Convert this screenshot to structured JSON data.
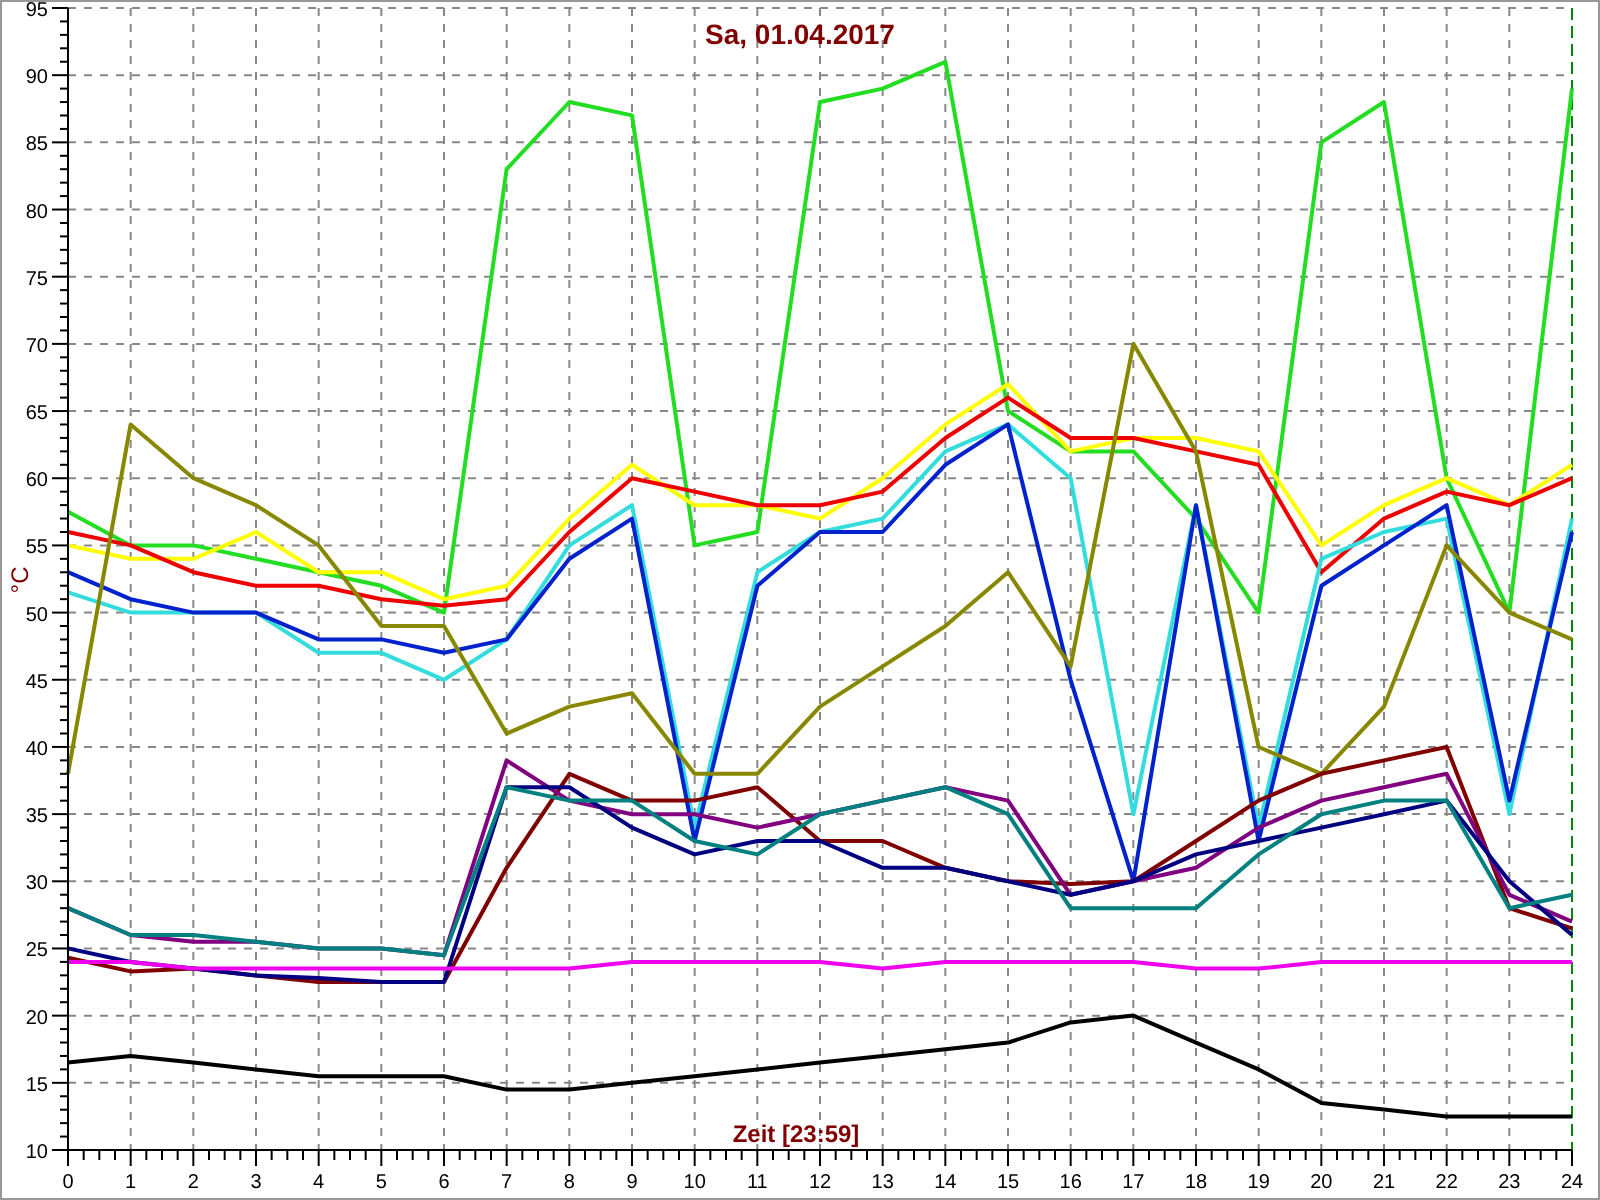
{
  "chart": {
    "chart_data": {
      "type": "line",
      "title": "Sa, 01.04.2017",
      "xlabel": "Zeit [23:59]",
      "ylabel": "°C",
      "x": [
        0,
        1,
        2,
        3,
        4,
        5,
        6,
        7,
        8,
        9,
        10,
        11,
        12,
        13,
        14,
        15,
        16,
        17,
        18,
        19,
        20,
        21,
        22,
        23,
        24
      ],
      "grid": true,
      "xlim": [
        0,
        24
      ],
      "ylim": [
        10,
        95
      ],
      "xticks": [
        0,
        1,
        2,
        3,
        4,
        5,
        6,
        7,
        8,
        9,
        10,
        11,
        12,
        13,
        14,
        15,
        16,
        17,
        18,
        19,
        20,
        21,
        22,
        23,
        24
      ],
      "yticks": [
        10,
        15,
        20,
        25,
        30,
        35,
        40,
        45,
        50,
        55,
        60,
        65,
        70,
        75,
        80,
        85,
        90,
        95
      ],
      "series": [
        {
          "color": "#22dd22",
          "values": [
            57.5,
            55,
            55,
            54,
            53,
            52,
            50,
            83,
            88,
            87,
            55,
            56,
            88,
            89,
            91,
            65,
            62,
            62,
            57,
            50,
            85,
            88,
            60,
            50,
            89
          ]
        },
        {
          "color": "#ffff00",
          "values": [
            55,
            54,
            54,
            56,
            53,
            53,
            51,
            52,
            57,
            61,
            58,
            58,
            57,
            60,
            64,
            67,
            62,
            63,
            63,
            62,
            55,
            58,
            60,
            58,
            61
          ]
        },
        {
          "color": "#ee0000",
          "values": [
            56,
            55,
            53,
            52,
            52,
            51,
            50.5,
            51,
            56,
            60,
            59,
            58,
            58,
            59,
            63,
            66,
            63,
            63,
            62,
            61,
            53,
            57,
            59,
            58,
            60
          ]
        },
        {
          "color": "#33dddd",
          "values": [
            51.5,
            50,
            50,
            50,
            47,
            47,
            45,
            48,
            55,
            58,
            34,
            53,
            56,
            57,
            62,
            64,
            60,
            35,
            58,
            34,
            54,
            56,
            57,
            35,
            57
          ]
        },
        {
          "color": "#0022cc",
          "values": [
            53,
            51,
            50,
            50,
            48,
            48,
            47,
            48,
            54,
            57,
            33,
            52,
            56,
            56,
            61,
            64,
            45,
            30,
            58,
            33,
            52,
            55,
            58,
            36,
            56
          ]
        },
        {
          "color": "#888800",
          "values": [
            38,
            64,
            60,
            58,
            55,
            49,
            49,
            41,
            43,
            44,
            38,
            38,
            43,
            46,
            49,
            53,
            46,
            70,
            62,
            40,
            38,
            43,
            55,
            50,
            48
          ]
        },
        {
          "color": "#800000",
          "values": [
            24.3,
            23.3,
            23.5,
            23,
            22.5,
            22.5,
            22.5,
            31,
            38,
            36,
            36,
            37,
            33,
            33,
            31,
            30,
            29.8,
            30,
            33,
            36,
            38,
            39,
            40,
            28,
            26.5
          ]
        },
        {
          "color": "#800080",
          "values": [
            28,
            26,
            25.5,
            25.5,
            25,
            25,
            24.5,
            39,
            36,
            35,
            35,
            34,
            35,
            36,
            37,
            36,
            29,
            30,
            31,
            34,
            36,
            37,
            38,
            29,
            27
          ]
        },
        {
          "color": "#000080",
          "values": [
            25,
            24,
            23.5,
            23,
            22.8,
            22.5,
            22.5,
            37,
            37,
            34,
            32,
            33,
            33,
            31,
            31,
            30,
            29,
            30,
            32,
            33,
            34,
            35,
            36,
            30,
            26
          ]
        },
        {
          "color": "#008080",
          "values": [
            28,
            26,
            26,
            25.5,
            25,
            25,
            24.5,
            37,
            36,
            36,
            33,
            32,
            35,
            36,
            37,
            35,
            28,
            28,
            28,
            32,
            35,
            36,
            36,
            28,
            29
          ]
        },
        {
          "color": "#ee00ee",
          "values": [
            24,
            24,
            23.5,
            23.5,
            23.5,
            23.5,
            23.5,
            23.5,
            23.5,
            24,
            24,
            24,
            24,
            23.5,
            24,
            24,
            24,
            24,
            23.5,
            23.5,
            24,
            24,
            24,
            24,
            24
          ]
        },
        {
          "color": "#000000",
          "values": [
            16.5,
            17,
            16.5,
            16,
            15.5,
            15.5,
            15.5,
            14.5,
            14.5,
            15,
            15.5,
            16,
            16.5,
            17,
            17.5,
            18,
            19.5,
            20,
            18,
            16,
            13.5,
            13,
            12.5,
            12.5,
            12.5
          ]
        }
      ]
    }
  }
}
